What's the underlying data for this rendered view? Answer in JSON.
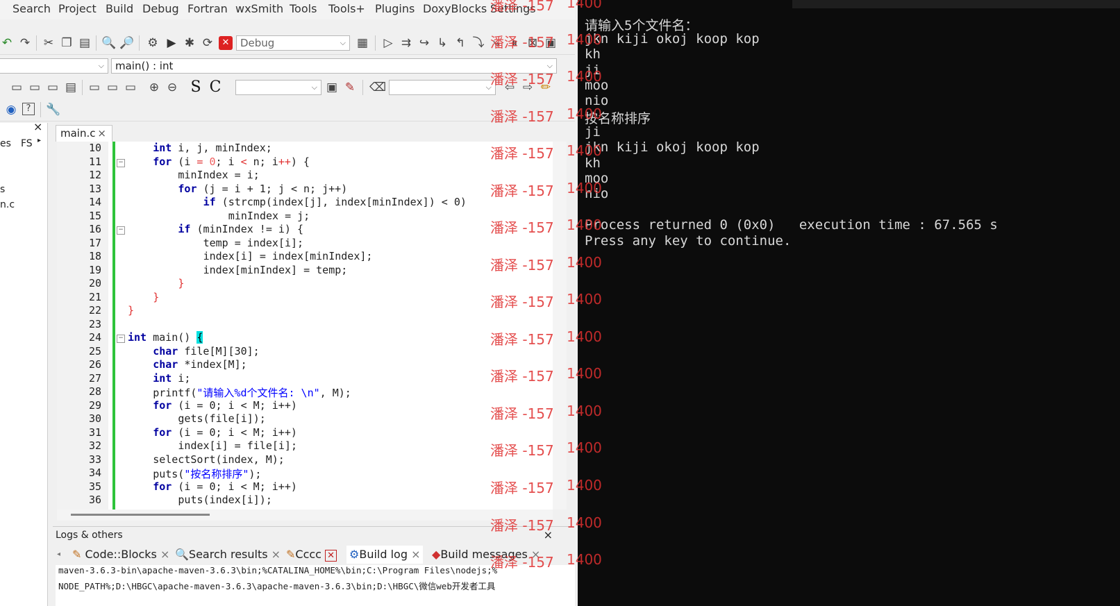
{
  "menu": [
    "Search",
    "Project",
    "Build",
    "Debug",
    "Fortran",
    "wxSmith",
    "Tools",
    "Tools+",
    "Plugins",
    "DoxyBlocks",
    "Settings"
  ],
  "toolbar": {
    "build_target": "Debug",
    "scope_value": "",
    "function_value": "main() : int",
    "s_label": "S",
    "c_label": "C"
  },
  "management": {
    "close": "×",
    "tab_partial_1": "es",
    "tab_partial_2": "FS",
    "item_1": "s",
    "item_2": "n.c"
  },
  "editor": {
    "tab_label": "main.c",
    "tab_close": "×",
    "line_numbers": [
      "10",
      "11",
      "12",
      "13",
      "14",
      "15",
      "16",
      "17",
      "18",
      "19",
      "20",
      "21",
      "22",
      "23",
      "24",
      "25",
      "26",
      "27",
      "28",
      "29",
      "30",
      "31",
      "32",
      "33",
      "34",
      "35",
      "36"
    ],
    "code": {
      "l10_kw": "int",
      "l10_rest": " i, j, minIndex;",
      "l11_kw": "for",
      "l11_a": " (i ",
      "l11_b": "=",
      "l11_c": " ",
      "l11_d": "0",
      "l11_e": "; i ",
      "l11_f": "<",
      "l11_g": " n; i",
      "l11_h": "++",
      "l11_i": ") {",
      "l12": "minIndex = i;",
      "l13_kw": "for",
      "l13_rest": " (j = i + 1; j < n; j++)",
      "l14_kw": "if",
      "l14_rest": " (strcmp(index[j], index[minIndex]) < 0)",
      "l15": "minIndex = j;",
      "l16_kw": "if",
      "l16_rest": " (minIndex != i) {",
      "l17": "temp = index[i];",
      "l18": "index[i] = index[minIndex];",
      "l19": "index[minIndex] = temp;",
      "l20": "}",
      "l21": "}",
      "l22": "}",
      "l24_kw": "int",
      "l24_rest": " main() ",
      "l24_brace": "{",
      "l25_kw": "char",
      "l25_rest": " file[M][30];",
      "l26_kw": "char",
      "l26_rest": " *index[M];",
      "l27_kw": "int",
      "l27_rest": " i;",
      "l28_a": "printf(",
      "l28_str": "\"请输入%d个文件名: \\n\"",
      "l28_b": ", M);",
      "l29_kw": "for",
      "l29_rest": " (i = 0; i < M; i++)",
      "l30": "gets(file[i]);",
      "l31_kw": "for",
      "l31_rest": " (i = 0; i < M; i++)",
      "l32": "index[i] = file[i];",
      "l33": "selectSort(index, M);",
      "l34_a": "puts(",
      "l34_str": "\"按名称排序\"",
      "l34_b": ");",
      "l35_kw": "for",
      "l35_rest": " (i = 0; i < M; i++)",
      "l36": "puts(index[i]);"
    }
  },
  "logs": {
    "title": "Logs & others",
    "close": "×",
    "tabs": [
      "Code::Blocks",
      "Search results",
      "Cccc",
      "Build log",
      "Build messages"
    ],
    "lines": [
      "maven-3.6.3-bin\\apache-maven-3.6.3\\bin;%CATALINA_HOME%\\bin;C:\\Program Files\\nodejs;%",
      "NODE_PATH%;D:\\HBGC\\apache-maven-3.6.3\\apache-maven-3.6.3\\bin;D:\\HBGC\\微信web开发者工具"
    ]
  },
  "console": {
    "lines": [
      "请输入5个文件名：",
      "jkn kiji okoj koop kop",
      "kh",
      "ji",
      "moo",
      "nio",
      "按名称排序",
      "ji",
      "jkn kiji okoj koop kop",
      "kh",
      "moo",
      "nio",
      "",
      "Process returned 0 (0x0)   execution time : 67.565 s",
      "Press any key to continue."
    ]
  },
  "watermark": {
    "text_left": "潘泽 -157",
    "text_right": "1400"
  },
  "colors": {
    "keyword": "#0000a0",
    "operator": "#e03030",
    "string": "#0000ff",
    "change_bar": "#2ec33a",
    "console_bg": "#0c0c0c",
    "watermark": "#e03030"
  }
}
